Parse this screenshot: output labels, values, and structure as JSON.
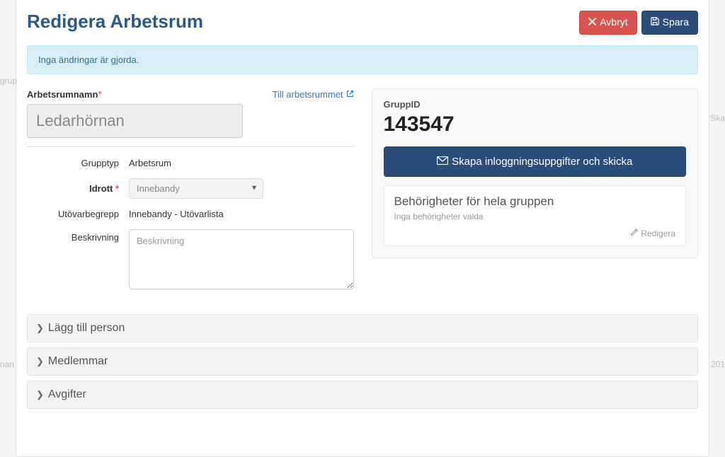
{
  "header": {
    "title": "Redigera Arbetsrum",
    "cancel_label": "Avbryt",
    "save_label": "Spara"
  },
  "alert": {
    "message": "Inga ändringar är gjorda."
  },
  "left": {
    "name_label": "Arbetsrumnamn",
    "name_value": "Ledarhörnan",
    "to_room_link": "Till arbetsrummet",
    "grupptyp_label": "Grupptyp",
    "grupptyp_value": "Arbetsrum",
    "idrott_label": "Idrott",
    "idrott_value": "Innebandy",
    "utovar_label": "Utövarbegrepp",
    "utovar_value": "Innebandy - Utövarlista",
    "beskrivning_label": "Beskrivning",
    "beskrivning_placeholder": "Beskrivning"
  },
  "right": {
    "gruppid_label": "GruppID",
    "gruppid_value": "143547",
    "create_login_label": "Skapa inloggningsuppgifter och skicka",
    "perm_title": "Behörigheter för hela gruppen",
    "perm_sub": "Inga behörigheter valda",
    "perm_edit": "Redigera"
  },
  "accordion": {
    "add_person": "Lägg till person",
    "members": "Medlemmar",
    "fees": "Avgifter"
  }
}
